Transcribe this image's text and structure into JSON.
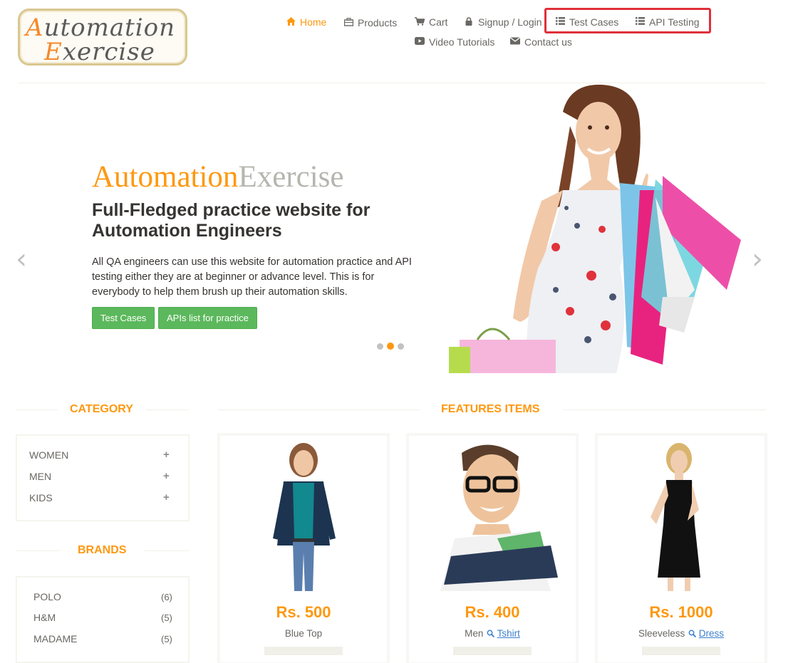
{
  "logo": {
    "line1_cap": "A",
    "line1_rest": "utomation",
    "line2_cap": "E",
    "line2_rest": "xercise"
  },
  "nav": {
    "home": "Home",
    "products": "Products",
    "cart": "Cart",
    "signup": "Signup / Login",
    "test_cases": "Test Cases",
    "api_testing": "API Testing",
    "video_tutorials": "Video Tutorials",
    "contact_us": "Contact us"
  },
  "slider": {
    "brand_a": "Automation",
    "brand_b": "Exercise",
    "heading": "Full-Fledged practice website for Automation Engineers",
    "text": "All QA engineers can use this website for automation practice and API testing either they are at beginner or advance level. This is for everybody to help them brush up their automation skills.",
    "btn_test_cases": "Test Cases",
    "btn_apis": "APIs list for practice",
    "prev_arrow": "‹",
    "next_arrow": "›",
    "active_slide": 2,
    "slide_count": 3
  },
  "category": {
    "title": "CATEGORY",
    "items": [
      "WOMEN",
      "MEN",
      "KIDS"
    ],
    "expand_symbol": "+"
  },
  "brands": {
    "title": "BRANDS",
    "items": [
      {
        "name": "POLO",
        "count": "(6)"
      },
      {
        "name": "H&M",
        "count": "(5)"
      },
      {
        "name": "MADAME",
        "count": "(5)"
      }
    ]
  },
  "features": {
    "title": "FEATURES ITEMS",
    "products": [
      {
        "price": "Rs. 500",
        "name": "Blue Top",
        "link": ""
      },
      {
        "price": "Rs. 400",
        "name": "Men",
        "link": "Tshirt"
      },
      {
        "price": "Rs. 1000",
        "name": "Sleeveless",
        "link": "Dress"
      }
    ]
  },
  "colors": {
    "accent": "#fe980f",
    "button_green": "#5cb85c",
    "highlight_red": "#e0303a"
  }
}
